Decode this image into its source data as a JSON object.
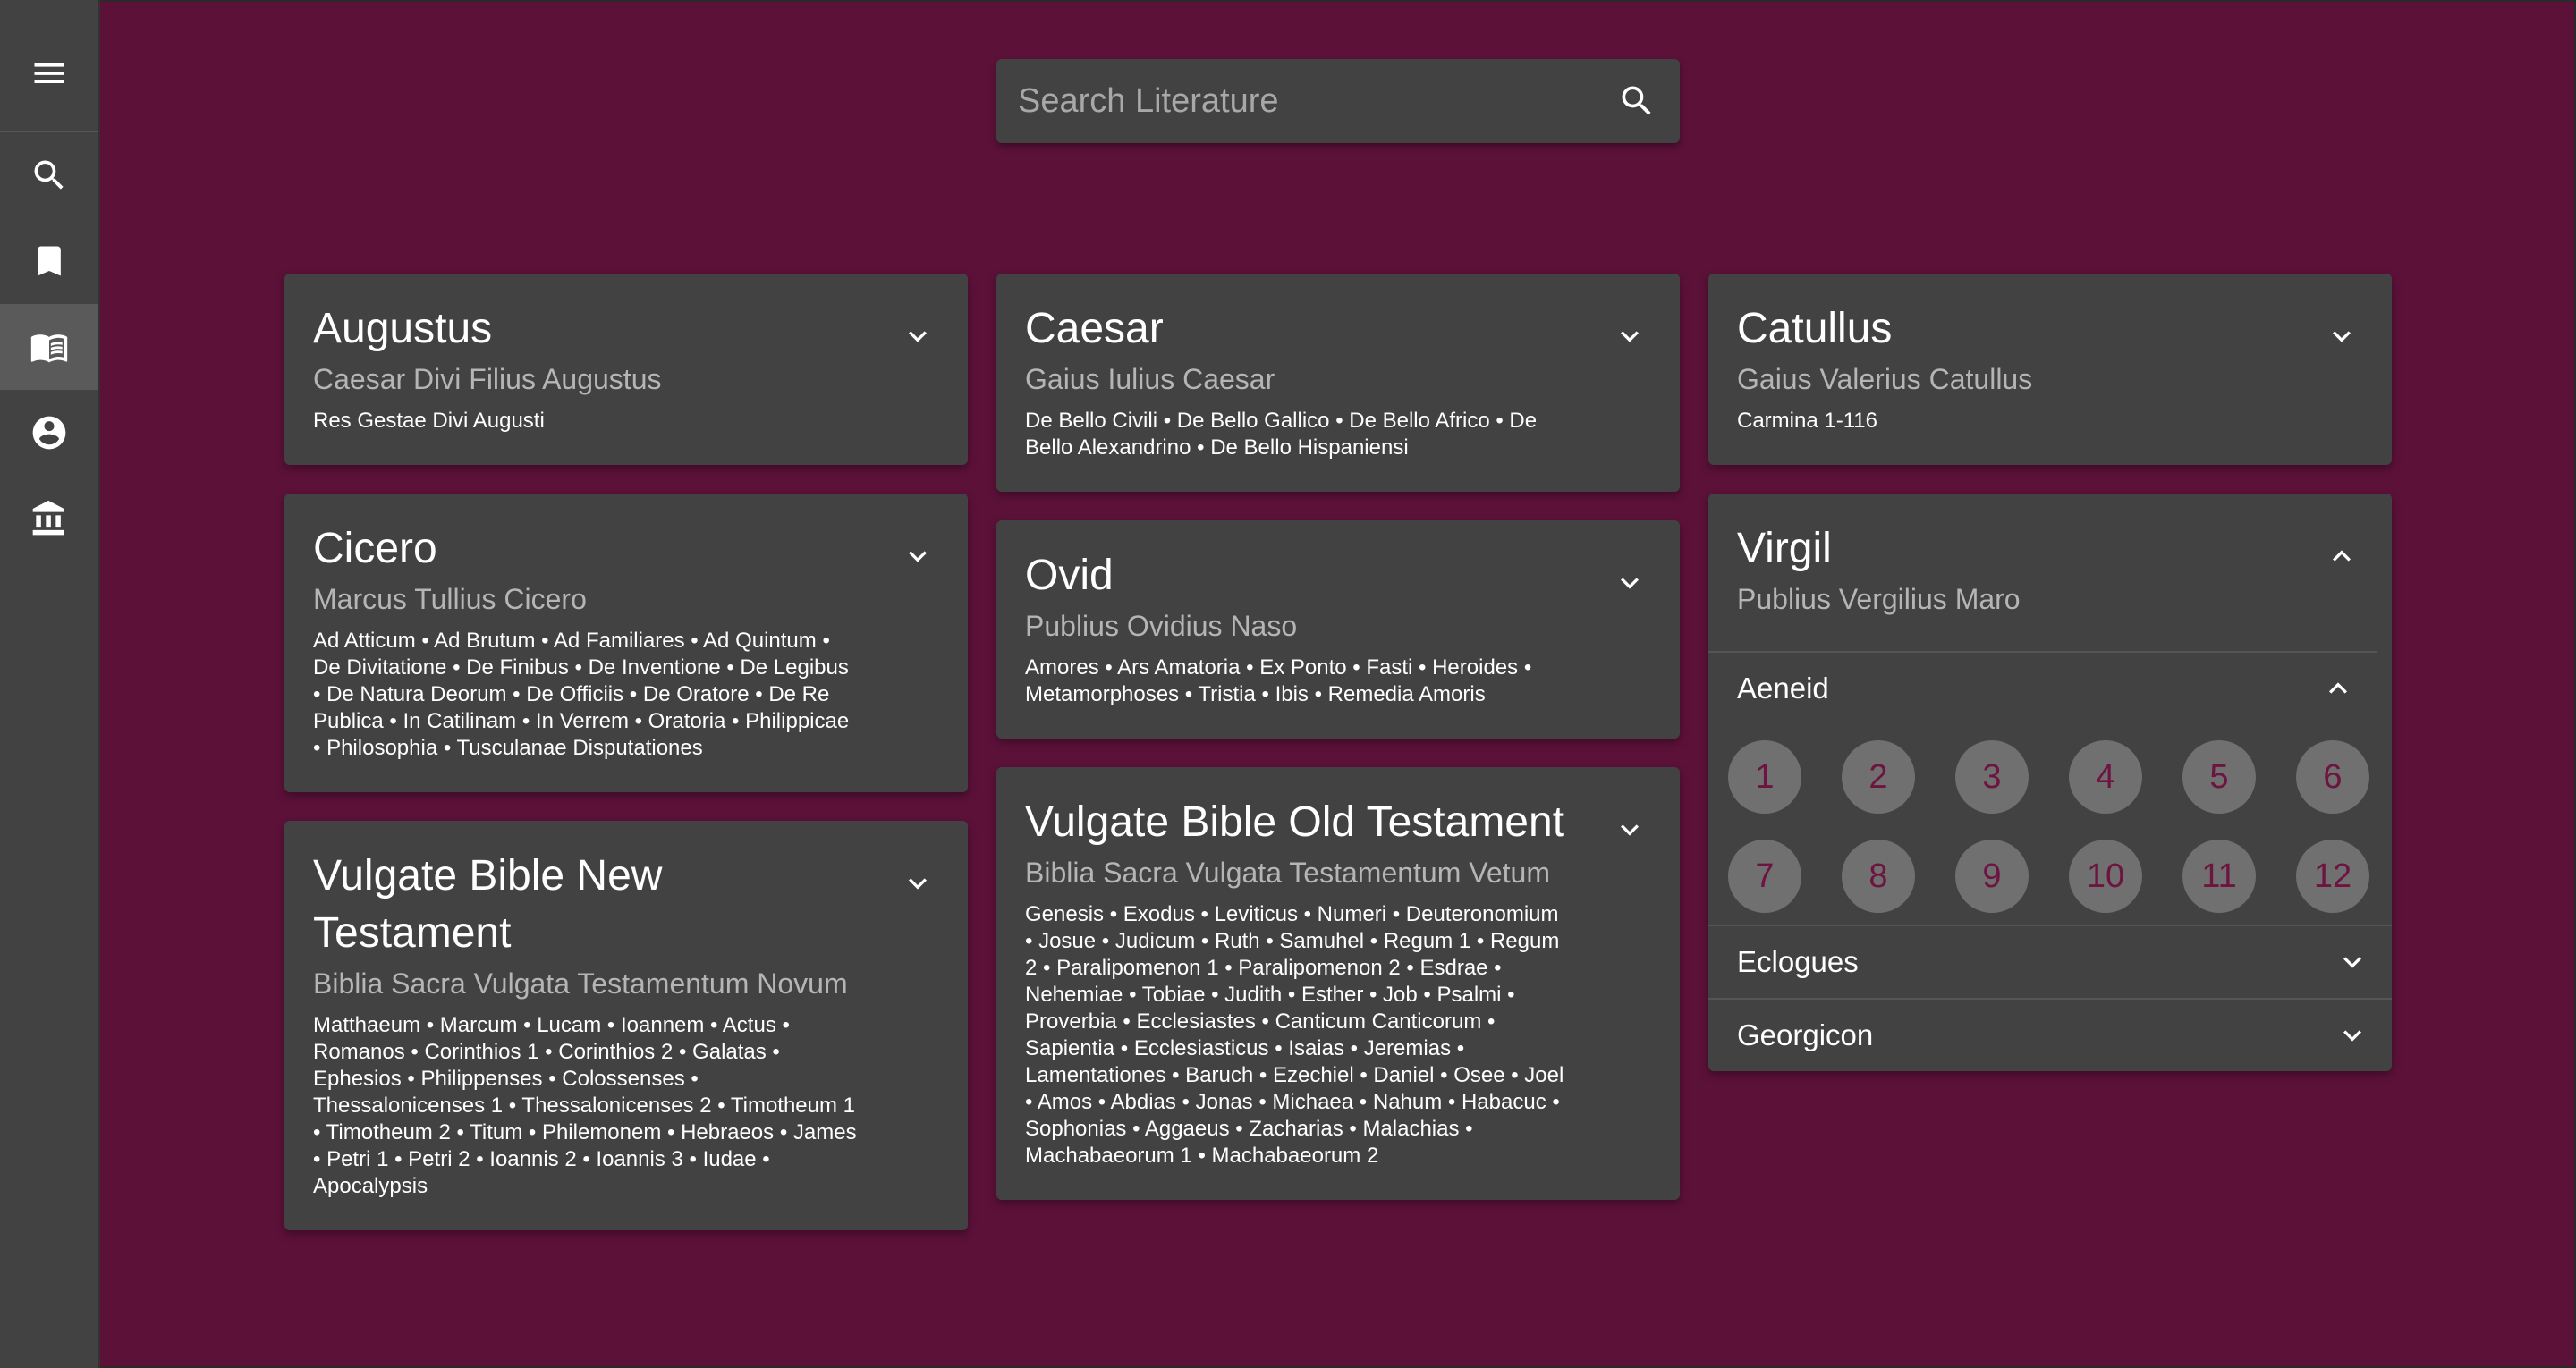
{
  "sidebar": {
    "menu_icon": "menu-icon",
    "items": [
      {
        "icon": "search-icon"
      },
      {
        "icon": "bookmark-icon"
      },
      {
        "icon": "book-open-icon",
        "active": true
      },
      {
        "icon": "account-icon"
      },
      {
        "icon": "bank-icon"
      }
    ]
  },
  "search": {
    "placeholder": "Search Literature",
    "value": ""
  },
  "colors": {
    "background": "#5c1139",
    "card": "#424242",
    "sidebar": "#424242",
    "circle": "#707070",
    "circle_text": "#6d1441"
  },
  "cards": {
    "augustus": {
      "title": "Augustus",
      "subtitle": "Caesar Divi Filius Augustus",
      "works": "Res Gestae Divi Augusti"
    },
    "caesar": {
      "title": "Caesar",
      "subtitle": "Gaius Iulius Caesar",
      "works": "De Bello Civili • De Bello Gallico • De Bello Africo • De Bello Alexandrino • De Bello Hispaniensi"
    },
    "catullus": {
      "title": "Catullus",
      "subtitle": "Gaius Valerius Catullus",
      "works": "Carmina 1-116"
    },
    "cicero": {
      "title": "Cicero",
      "subtitle": "Marcus Tullius Cicero",
      "works": "Ad Atticum • Ad Brutum • Ad Familiares • Ad Quintum • De Divitatione • De Finibus • De Inventione • De Legibus • De Natura Deorum • De Officiis • De Oratore • De Re Publica • In Catilinam • In Verrem • Oratoria • Philippicae • Philosophia • Tusculanae Disputationes"
    },
    "ovid": {
      "title": "Ovid",
      "subtitle": "Publius Ovidius Naso",
      "works": "Amores • Ars Amatoria • Ex Ponto • Fasti • Heroides • Metamorphoses • Tristia • Ibis • Remedia Amoris"
    },
    "vulgate_nt": {
      "title": "Vulgate Bible New Testament",
      "subtitle": "Biblia Sacra Vulgata Testamentum Novum",
      "works": "Matthaeum • Marcum • Lucam • Ioannem • Actus • Romanos • Corinthios 1 • Corinthios 2 • Galatas • Ephesios • Philippenses • Colossenses • Thessalonicenses 1 • Thessalonicenses 2 • Timotheum 1 • Timotheum 2 • Titum • Philemonem • Hebraeos • James • Petri 1 • Petri 2 • Ioannis 2 • Ioannis 3 • Iudae • Apocalypsis"
    },
    "vulgate_ot": {
      "title": "Vulgate Bible Old Testament",
      "subtitle": "Biblia Sacra Vulgata Testamentum Vetum",
      "works": "Genesis • Exodus • Leviticus • Numeri • Deuteronomium • Josue • Judicum • Ruth • Samuhel • Regum 1 • Regum 2 • Paralipomenon 1 • Paralipomenon 2 • Esdrae • Nehemiae • Tobiae • Judith • Esther • Job • Psalmi • Proverbia • Ecclesiastes • Canticum Canticorum • Sapientia • Ecclesiasticus • Isaias • Jeremias • Lamentationes • Baruch • Ezechiel • Daniel • Osee • Joel • Amos • Abdias • Jonas • Michaea • Nahum • Habacuc • Sophonias • Aggaeus • Zacharias • Malachias • Machabaeorum 1 • Machabaeorum 2"
    },
    "virgil": {
      "title": "Virgil",
      "subtitle": "Publius Vergilius Maro",
      "books": [
        {
          "label": "Aeneid",
          "expanded": true,
          "sections": [
            "1",
            "2",
            "3",
            "4",
            "5",
            "6",
            "7",
            "8",
            "9",
            "10",
            "11",
            "12"
          ]
        },
        {
          "label": "Eclogues",
          "expanded": false
        },
        {
          "label": "Georgicon",
          "expanded": false
        }
      ]
    }
  }
}
